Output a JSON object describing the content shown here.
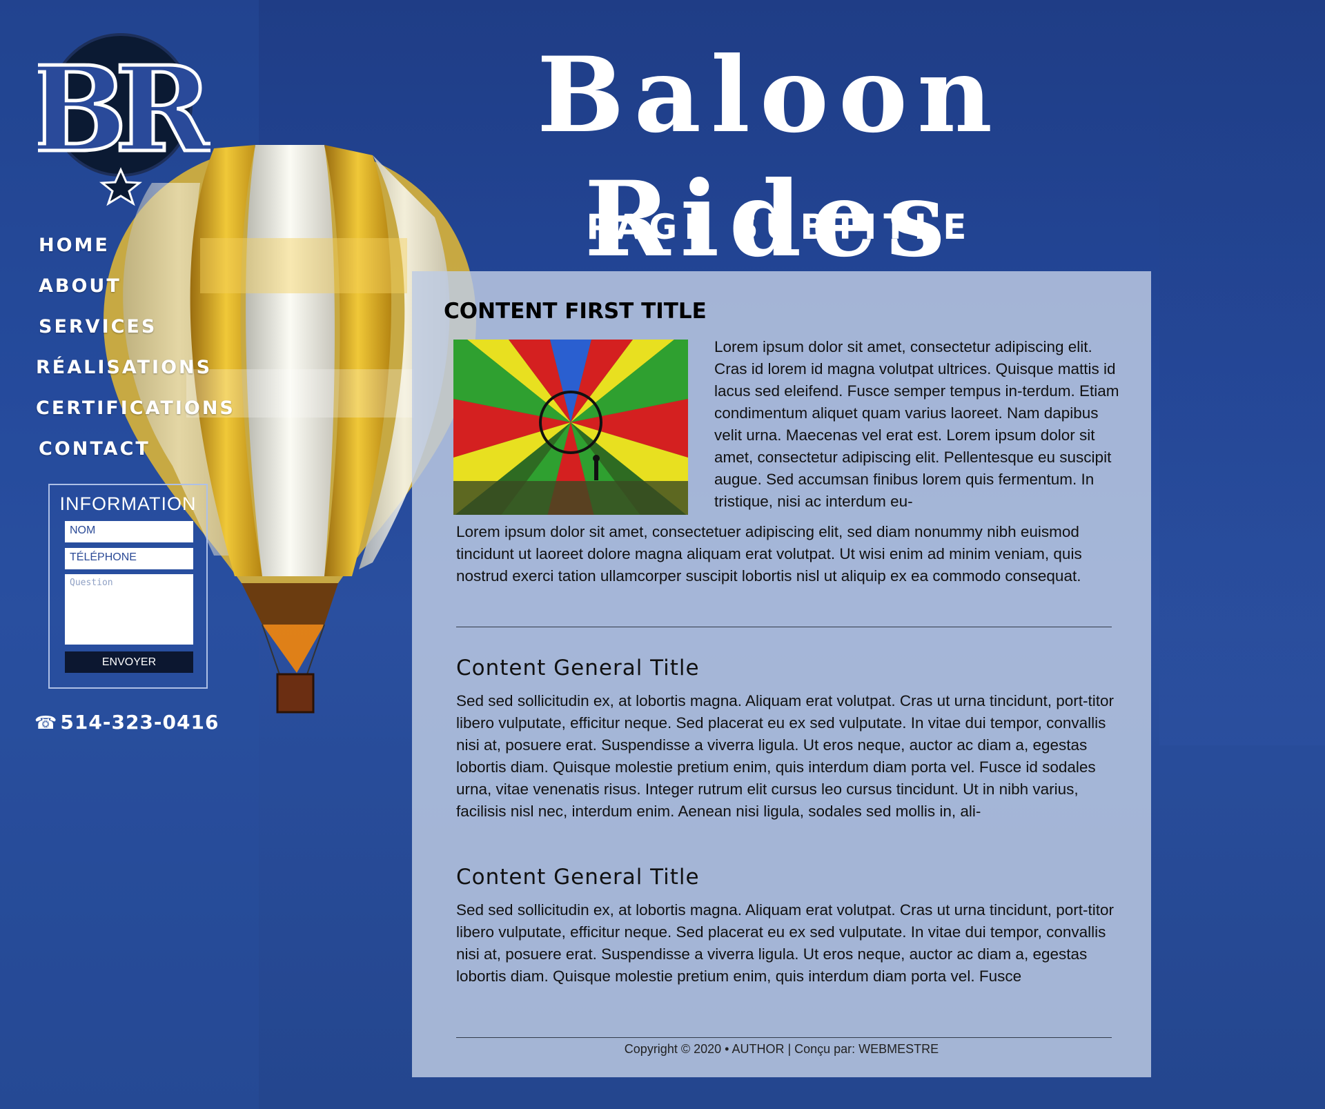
{
  "site": {
    "title": "Baloon Rides",
    "subtitle": "PAGE SUBTITLE",
    "logo_text": "BR"
  },
  "nav": {
    "items": [
      {
        "label": "HOME"
      },
      {
        "label": "ABOUT"
      },
      {
        "label": "SERVICES"
      },
      {
        "label": "RÉALISATIONS"
      },
      {
        "label": "CERTIFICATIONS"
      },
      {
        "label": "CONTACT"
      }
    ]
  },
  "info_form": {
    "title": "INFORMATION",
    "name_placeholder": "NOM",
    "phone_placeholder": "TÉLÉPHONE",
    "question_placeholder": "Question",
    "submit_label": "ENVOYER"
  },
  "phone": {
    "icon": "telephone-icon",
    "number": "514-323-0416"
  },
  "content": {
    "first_title": "CONTENT FIRST TITLE",
    "first_paragraph": "Lorem ipsum dolor sit amet, consectetur adipiscing elit. Cras id lorem id magna volutpat ultrices. Quisque mattis id lacus sed eleifend. Fusce semper tempus in-terdum. Etiam condimentum aliquet quam varius laoreet. Nam dapibus velit urna. Maecenas vel erat est. Lorem ipsum dolor sit amet, consectetur adipiscing elit. Pellentesque eu suscipit augue. Sed accumsan finibus lorem quis fermentum. In tristique, nisi ac interdum eu-",
    "second_paragraph": "Lorem ipsum dolor sit amet, consectetuer adipiscing elit, sed diam nonummy nibh euismod tincidunt ut laoreet dolore magna aliquam erat volutpat. Ut wisi enim ad minim veniam, quis nostrud exerci tation ullamcorper suscipit lobortis nisl ut aliquip ex ea commodo consequat.",
    "sections": [
      {
        "title": "Content General Title",
        "text": "Sed sed sollicitudin ex, at lobortis magna. Aliquam erat volutpat. Cras ut urna tincidunt, port-titor libero vulputate, efficitur neque. Sed placerat eu ex sed vulputate. In vitae dui tempor, convallis nisi at, posuere erat. Suspendisse a viverra ligula. Ut eros neque, auctor ac diam a, egestas lobortis diam. Quisque molestie pretium enim, quis interdum diam porta vel. Fusce id sodales urna, vitae venenatis risus. Integer rutrum elit cursus leo cursus tincidunt. Ut in nibh varius, facilisis nisl nec, interdum enim. Aenean nisi ligula, sodales sed mollis in, ali-"
      },
      {
        "title": "Content General Title",
        "text": "Sed sed sollicitudin ex, at lobortis magna. Aliquam erat volutpat. Cras ut urna tincidunt, port-titor libero vulputate, efficitur neque. Sed placerat eu ex sed vulputate. In vitae dui tempor, convallis nisi at, posuere erat. Suspendisse a viverra ligula. Ut eros neque, auctor ac diam a, egestas lobortis diam. Quisque molestie pretium enim, quis interdum diam porta vel. Fusce"
      }
    ]
  },
  "footer": {
    "text": "Copyright © 2020 • AUTHOR | Conçu par: WEBMESTRE"
  },
  "colors": {
    "background": "#25468f",
    "panel": "#bccbe3",
    "button": "#0c1730",
    "balloon_gold": "#e0b020",
    "logo_dark": "#0b1a33"
  }
}
